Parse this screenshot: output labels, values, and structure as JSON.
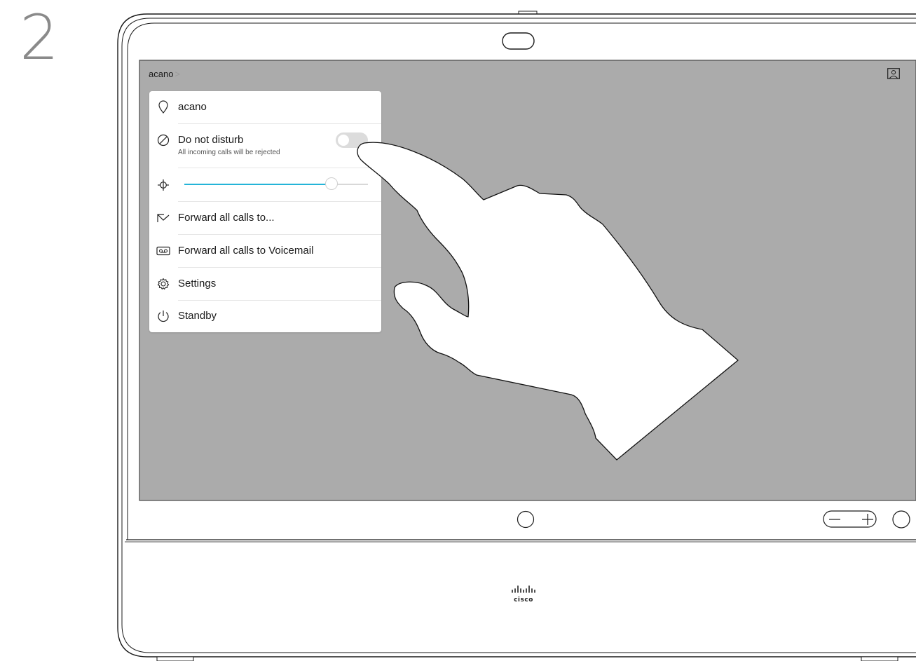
{
  "step": {
    "number": "2"
  },
  "screen": {
    "breadcrumb": {
      "label": "acano",
      "chevron": ">"
    },
    "self_view_icon": "self-view-icon"
  },
  "menu": {
    "location": {
      "label": "acano",
      "icon": "location-pin-icon"
    },
    "do_not_disturb": {
      "label": "Do not disturb",
      "sublabel": "All incoming calls will be rejected",
      "icon": "do-not-disturb-icon",
      "enabled": false
    },
    "brightness": {
      "icon": "brightness-icon",
      "level": 0.8
    },
    "forward_calls": {
      "label": "Forward all calls to...",
      "icon": "forward-arrow-icon"
    },
    "forward_voicemail": {
      "label": "Forward all calls to Voicemail",
      "icon": "voicemail-icon"
    },
    "settings": {
      "label": "Settings",
      "icon": "gear-icon"
    },
    "standby": {
      "label": "Standby",
      "icon": "power-icon"
    }
  },
  "device": {
    "volume": {
      "minus": "−",
      "plus": "+"
    },
    "brand": "cisco",
    "accent_color": "#25b4d8",
    "screen_color": "#ababab"
  }
}
